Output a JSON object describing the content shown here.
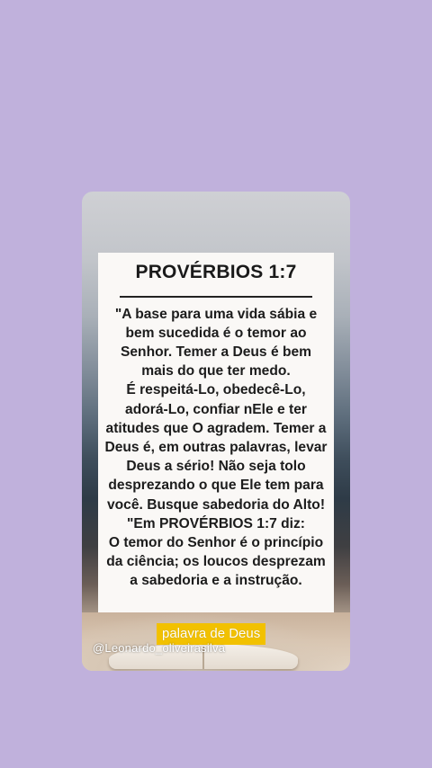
{
  "background_color": "#c0b1dc",
  "card": {
    "title": "PROVÉRBIOS 1:7",
    "body": "\"A base para uma vida sábia e bem sucedida é o temor ao Senhor. Temer a Deus é bem mais do que ter medo.\nÉ respeitá-Lo, obedecê-Lo, adorá-Lo, confiar nEle e ter atitudes que O agradem. Temer a Deus é, em outras palavras, levar Deus a sério! Não seja tolo desprezando o que Ele tem para você. Busque sabedoria do Alto!\n\"Em PROVÉRBIOS 1:7 diz:\nO temor do Senhor é o princípio da ciência; os loucos desprezam a sabedoria e a instrução.",
    "image_icon": "open-bible-icon"
  },
  "overlay": {
    "tag": "palavra de Deus",
    "tag_color": "#f2c100",
    "handle": "@Leonardo_oliveirasilva"
  }
}
